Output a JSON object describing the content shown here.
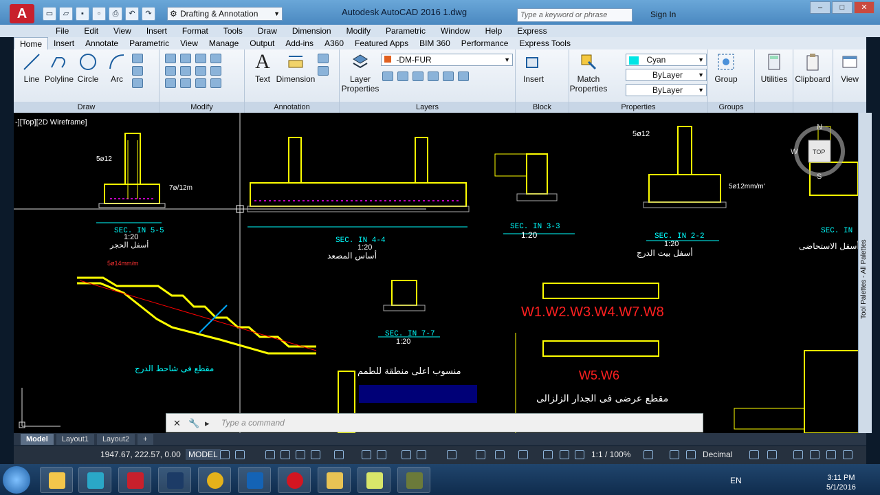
{
  "titlebar": {
    "workspace": "Drafting & Annotation",
    "title": "Autodesk AutoCAD 2016    1.dwg",
    "search_placeholder": "Type a keyword or phrase",
    "sign_in": "Sign In"
  },
  "menubar": [
    "File",
    "Edit",
    "View",
    "Insert",
    "Format",
    "Tools",
    "Draw",
    "Dimension",
    "Modify",
    "Parametric",
    "Window",
    "Help",
    "Express"
  ],
  "ribbon_tabs": [
    "Home",
    "Insert",
    "Annotate",
    "Parametric",
    "View",
    "Manage",
    "Output",
    "Add-ins",
    "A360",
    "Featured Apps",
    "BIM 360",
    "Performance",
    "Express Tools"
  ],
  "panels": {
    "draw": {
      "title": "Draw",
      "buttons": [
        "Line",
        "Polyline",
        "Circle",
        "Arc"
      ]
    },
    "modify": {
      "title": "Modify"
    },
    "annotation": {
      "title": "Annotation",
      "buttons": [
        "Text",
        "Dimension"
      ]
    },
    "layers": {
      "title": "Layers",
      "button": "Layer Properties",
      "current_layer": "-DM-FUR"
    },
    "block": {
      "title": "Block",
      "button": "Insert"
    },
    "properties": {
      "title": "Properties",
      "button": "Match Properties",
      "color": "Cyan",
      "linetype": "ByLayer",
      "lineweight": "ByLayer"
    },
    "groups": {
      "title": "Groups",
      "button": "Group"
    },
    "utilities": {
      "button": "Utilities"
    },
    "clipboard": {
      "button": "Clipboard"
    },
    "view": {
      "button": "View"
    }
  },
  "viewport_label": "-][Top][2D Wireframe]",
  "tool_palette": "Tool Palettes - All Palettes",
  "drawing_texts": {
    "sec55": "SEC. IN 5-5",
    "sec55_scale": "1:20",
    "sec44": "SEC. IN 4-4",
    "sec44_scale": "1:20",
    "sec33": "SEC. IN 3-3",
    "sec33_scale": "1:20",
    "sec22": "SEC. IN 2-2",
    "sec22_scale": "1:20",
    "sec77": "SEC. IN 7-7",
    "sec77_scale": "1:20",
    "sec1": "SEC. IN",
    "wall1": "W1.W2.W3.W4.W7.W8",
    "wall2": "W5.W6",
    "ar1": "أسفل الحجر",
    "ar2": "أساس المصعد",
    "ar3": "أسفل بيت الدرج",
    "ar4": "أسفل الاستحاضى",
    "ar5": "مقطع فى شاحط الدرج",
    "ar6": "منسوب اعلى منطقة للطمم",
    "ar7": "مقطع عرضى فى الجدار الزلزالى",
    "rebar1": "5ø12",
    "rebar2": "5ø12mm/m'",
    "rebar3": "7ø/12m",
    "rebar4": "5ø14mm/m",
    "compass_n": "N",
    "compass_w": "W",
    "compass_s": "S",
    "compass_top": "TOP"
  },
  "command": {
    "placeholder": "Type a command"
  },
  "layout_tabs": [
    "Model",
    "Layout1",
    "Layout2",
    "+"
  ],
  "status": {
    "coords": "1947.67, 222.57, 0.00",
    "model": "MODEL",
    "scale": "1:1 / 100%",
    "units": "Decimal"
  },
  "taskbar": {
    "lang": "EN",
    "time": "3:11 PM",
    "date": "5/1/2016"
  }
}
